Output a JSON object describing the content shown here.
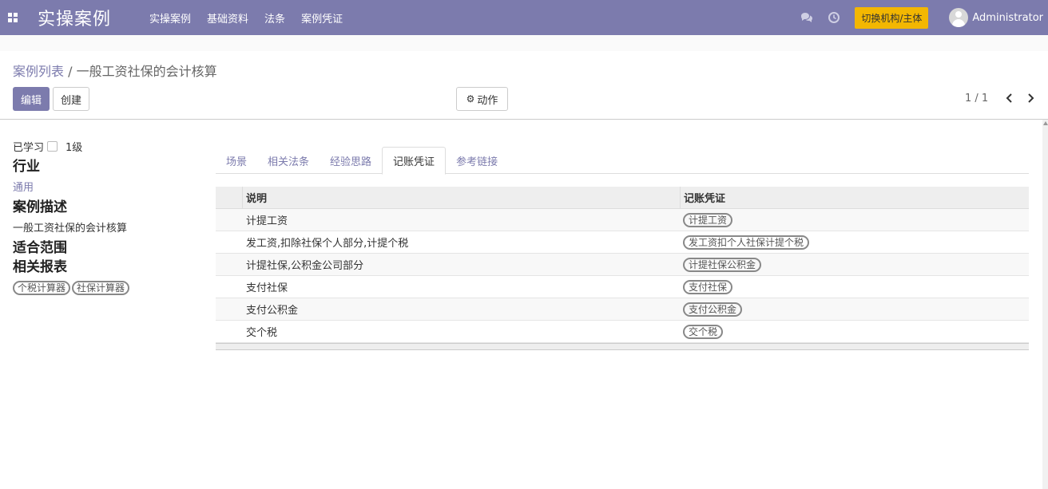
{
  "navbar": {
    "brand": "实操案例",
    "menu": [
      "实操案例",
      "基础资料",
      "法条",
      "案例凭证"
    ],
    "switch_label": "切换机构/主体",
    "user_name": "Administrator",
    "bg_color": "#7c7bad",
    "switch_color": "#f3b701"
  },
  "breadcrumb": {
    "parent": "案例列表",
    "sep": " / ",
    "current": "一般工资社保的会计核算"
  },
  "toolbar": {
    "edit_label": "编辑",
    "create_label": "创建",
    "action_label": "动作"
  },
  "pager": {
    "value": "1 / 1"
  },
  "sheet": {
    "learned_label": "已学习",
    "level": "1级",
    "industry_title": "行业",
    "industry_value": "通用",
    "desc_title": "案例描述",
    "desc_value": "一般工资社保的会计核算",
    "scope_title": "适合范围",
    "reports_title": "相关报表",
    "reports": [
      "个税计算器",
      "社保计算器"
    ]
  },
  "tabs": [
    "场景",
    "相关法条",
    "经验思路",
    "记账凭证",
    "参考链接"
  ],
  "active_tab": "记账凭证",
  "table": {
    "headers": [
      "说明",
      "记账凭证"
    ],
    "rows": [
      {
        "desc": "计提工资",
        "voucher": "计提工资"
      },
      {
        "desc": "发工资,扣除社保个人部分,计提个税",
        "voucher": "发工资扣个人社保计提个税"
      },
      {
        "desc": "计提社保,公积金公司部分",
        "voucher": "计提社保公积金"
      },
      {
        "desc": "支付社保",
        "voucher": "支付社保"
      },
      {
        "desc": "支付公积金",
        "voucher": "支付公积金"
      },
      {
        "desc": "交个税",
        "voucher": "交个税"
      }
    ]
  }
}
